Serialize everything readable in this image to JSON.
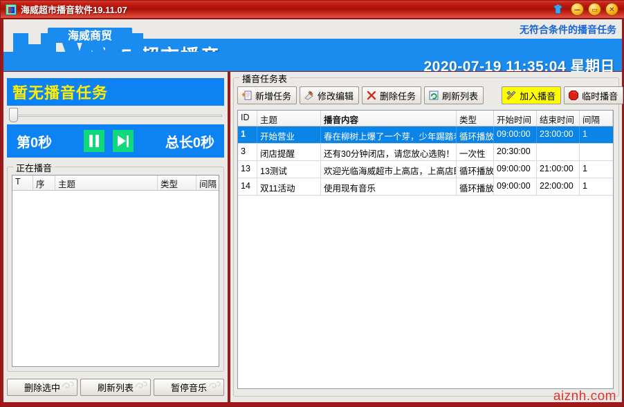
{
  "window": {
    "title": "海威超市播音软件19.11.07",
    "icon": "app-icon",
    "buttons": {
      "shirt": "shirt-icon",
      "minimize": "—",
      "maximize": "▭",
      "close": "✕"
    }
  },
  "header": {
    "logo_mark": "HWJ",
    "logo_text": "海威商贸",
    "banner_title": "海威超市播音",
    "status_note": "无符合条件的播音任务",
    "datetime": "2020-07-19 11:35:04 星期日"
  },
  "left_panel": {
    "status": "暂无播音任务",
    "slider_value": 0,
    "player": {
      "current_label": "第0秒",
      "pause_icon": "pause-icon",
      "next_icon": "next-track-icon",
      "total_label": "总长0秒"
    },
    "group_title": "正在播音",
    "table": {
      "columns": [
        "T",
        "序",
        "主题",
        "类型",
        "间隔"
      ],
      "rows": []
    },
    "buttons": [
      "删除选中",
      "刷新列表",
      "暂停音乐"
    ]
  },
  "main_panel": {
    "group_title": "播音任务表",
    "toolbar": [
      {
        "label": "新增任务",
        "icon": "new-task-icon",
        "highlight": false
      },
      {
        "label": "修改编辑",
        "icon": "edit-icon",
        "highlight": false
      },
      {
        "label": "删除任务",
        "icon": "delete-x-icon",
        "highlight": false
      },
      {
        "label": "刷新列表",
        "icon": "refresh-icon",
        "highlight": false
      },
      {
        "label": "加入播音",
        "icon": "tools-icon",
        "highlight": true
      },
      {
        "label": "临时播音",
        "icon": "stop-octagon-icon",
        "highlight": false
      }
    ],
    "table": {
      "columns": [
        "ID",
        "主题",
        "播音内容",
        "类型",
        "开始时间",
        "结束时间",
        "间隔"
      ],
      "rows": [
        {
          "id": "1",
          "subject": "开始营业",
          "content": "春在柳树上爆了一个芽，少年踢踏着",
          "type": "循环播放",
          "start": "09:00:00",
          "end": "23:00:00",
          "interval": "1",
          "selected": true
        },
        {
          "id": "3",
          "subject": "闭店提醒",
          "content": "还有30分钟闭店，请您放心选购！",
          "type": "一次性",
          "start": "20:30:00",
          "end": "",
          "interval": "",
          "selected": false
        },
        {
          "id": "13",
          "subject": "13测试",
          "content": "欢迎光临海威超市上高店，上高店即",
          "type": "循环播放",
          "start": "09:00:00",
          "end": "21:00:00",
          "interval": "1",
          "selected": false
        },
        {
          "id": "14",
          "subject": "双11活动",
          "content": "使用现有音乐",
          "type": "循环播放",
          "start": "09:00:00",
          "end": "22:00:00",
          "interval": "1",
          "selected": false
        }
      ]
    }
  },
  "watermark": "aiznh.com",
  "colors": {
    "titlebar_red": "#b3160b",
    "frame_red": "#9e1a1a",
    "banner_blue": "#1a8cf0",
    "status_blue": "#0d82f2",
    "status_yellow": "#ffee00",
    "player_green": "#0fd97b",
    "selection_blue": "#0b84e8",
    "highlight_yellow": "#ffff00",
    "watermark_red": "#e2332b"
  }
}
